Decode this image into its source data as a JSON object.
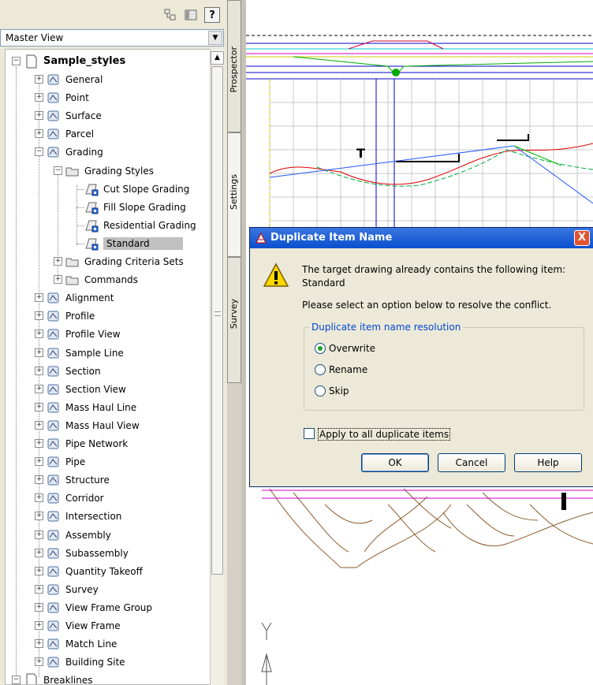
{
  "toolbar": {
    "icons": [
      "item-view-icon",
      "panel-icon",
      "help-icon"
    ],
    "help_label": "?"
  },
  "view_selector": {
    "value": "Master View"
  },
  "tree": {
    "root": "Sample_styles",
    "items": [
      {
        "label": "General",
        "level": 1,
        "expander": "+"
      },
      {
        "label": "Point",
        "level": 1,
        "expander": "+"
      },
      {
        "label": "Surface",
        "level": 1,
        "expander": "+"
      },
      {
        "label": "Parcel",
        "level": 1,
        "expander": "+"
      },
      {
        "label": "Grading",
        "level": 1,
        "expander": "−"
      },
      {
        "label": "Grading Styles",
        "level": 2,
        "expander": "−"
      },
      {
        "label": "Cut Slope Grading",
        "level": 3
      },
      {
        "label": "Fill Slope Grading",
        "level": 3
      },
      {
        "label": "Residential Grading",
        "level": 3
      },
      {
        "label": "Standard",
        "level": 3,
        "selected": true
      },
      {
        "label": "Grading Criteria Sets",
        "level": 2,
        "expander": "+"
      },
      {
        "label": "Commands",
        "level": 2,
        "expander": "+"
      },
      {
        "label": "Alignment",
        "level": 1,
        "expander": "+"
      },
      {
        "label": "Profile",
        "level": 1,
        "expander": "+"
      },
      {
        "label": "Profile View",
        "level": 1,
        "expander": "+"
      },
      {
        "label": "Sample Line",
        "level": 1,
        "expander": "+"
      },
      {
        "label": "Section",
        "level": 1,
        "expander": "+"
      },
      {
        "label": "Section View",
        "level": 1,
        "expander": "+"
      },
      {
        "label": "Mass Haul Line",
        "level": 1,
        "expander": "+"
      },
      {
        "label": "Mass Haul View",
        "level": 1,
        "expander": "+"
      },
      {
        "label": "Pipe Network",
        "level": 1,
        "expander": "+"
      },
      {
        "label": "Pipe",
        "level": 1,
        "expander": "+"
      },
      {
        "label": "Structure",
        "level": 1,
        "expander": "+"
      },
      {
        "label": "Corridor",
        "level": 1,
        "expander": "+"
      },
      {
        "label": "Intersection",
        "level": 1,
        "expander": "+"
      },
      {
        "label": "Assembly",
        "level": 1,
        "expander": "+"
      },
      {
        "label": "Subassembly",
        "level": 1,
        "expander": "+"
      },
      {
        "label": "Quantity Takeoff",
        "level": 1,
        "expander": "+"
      },
      {
        "label": "Survey",
        "level": 1,
        "expander": "+"
      },
      {
        "label": "View Frame Group",
        "level": 1,
        "expander": "+"
      },
      {
        "label": "View Frame",
        "level": 1,
        "expander": "+"
      },
      {
        "label": "Match Line",
        "level": 1,
        "expander": "+"
      },
      {
        "label": "Building Site",
        "level": 1,
        "expander": "+"
      },
      {
        "label": "Breaklines",
        "level": 0,
        "expander": "−"
      }
    ]
  },
  "tabs": [
    {
      "label": "Prospector",
      "active": false
    },
    {
      "label": "Settings",
      "active": true
    },
    {
      "label": "Survey",
      "active": false
    }
  ],
  "dialog": {
    "title": "Duplicate Item Name",
    "message_line1": "The target drawing already contains the following item:",
    "message_line2": "Standard",
    "instruction": "Please select an option below to resolve the conflict.",
    "group_label": "Duplicate item name resolution",
    "options": [
      {
        "label": "Overwrite",
        "checked": true
      },
      {
        "label": "Rename",
        "checked": false
      },
      {
        "label": "Skip",
        "checked": false
      }
    ],
    "apply_all_label": "Apply to all duplicate items",
    "apply_all_checked": false,
    "buttons": {
      "ok": "OK",
      "cancel": "Cancel",
      "help": "Help"
    },
    "close_glyph": "X"
  },
  "colors": {
    "title_bar": "#0a4fd0",
    "selection": "#c0c0c0",
    "group_label": "#0046d5",
    "close_button": "#e0552f"
  }
}
